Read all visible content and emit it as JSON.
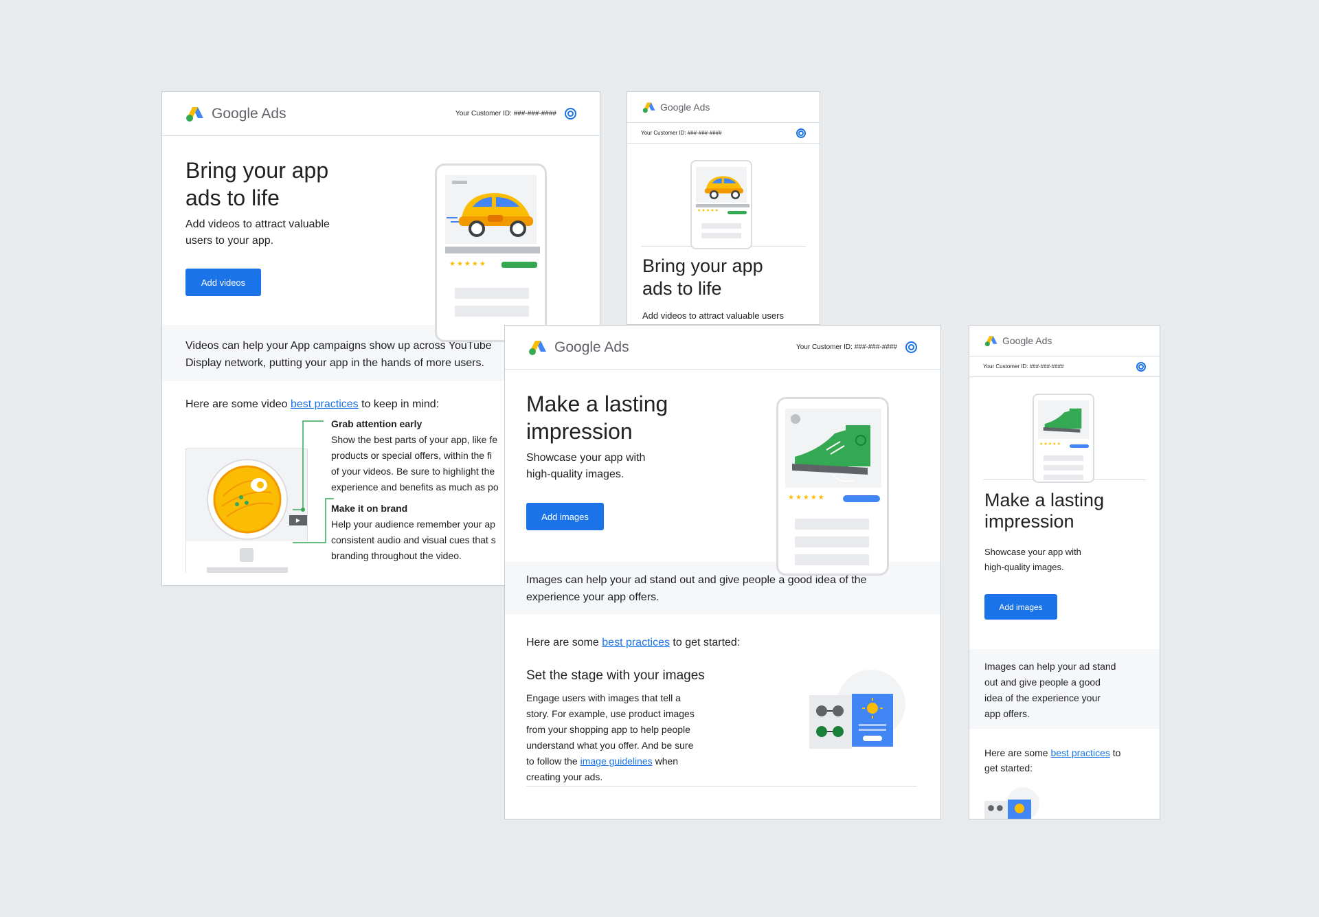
{
  "brand": {
    "name": "Google Ads",
    "customer_id": "Your Customer ID: ###-###-####"
  },
  "colors": {
    "accent": "#1a73e8",
    "logo_blue": "#4285f4",
    "logo_yellow": "#fbbc04",
    "logo_green": "#34a853",
    "background": "#e8ebed"
  },
  "video_email": {
    "title_line1": "Bring your app",
    "title_line2": "ads to life",
    "subtitle_line1": "Add videos to attract valuable",
    "subtitle_line2": "users to your app.",
    "cta": "Add videos",
    "band_line1": "Videos can help your App campaigns show up across YouTube",
    "band_line2": "Display network, putting your app in the hands of more users.",
    "tips_pre": "Here are some video ",
    "tips_link": "best practices",
    "tips_post": " to keep in mind:",
    "tip1_title": "Grab attention early",
    "tip1_l1": "Show the best parts of your app, like fe",
    "tip1_l2": "products or special offers, within the fi",
    "tip1_l3": "of your videos. Be sure to highlight the",
    "tip1_l4": "experience and benefits as much as po",
    "tip2_title": "Make it on brand",
    "tip2_l1": "Help your audience remember your ap",
    "tip2_l2": "consistent audio and visual cues that s",
    "tip2_l3": "branding throughout the video."
  },
  "video_mobile": {
    "title_line1": "Bring your app",
    "title_line2": "ads to life",
    "subtitle": "Add videos to attract valuable users"
  },
  "image_email": {
    "title_line1": "Make a lasting",
    "title_line2": "impression",
    "subtitle_line1": "Showcase your app with",
    "subtitle_line2": "high-quality images.",
    "cta": "Add images",
    "band_line1": "Images can help your ad stand out and give people a good idea of the",
    "band_line2": "experience your app offers.",
    "tips_pre": "Here are some ",
    "tips_link": "best practices",
    "tips_post": " to get started:",
    "section_title": "Set the stage with your images",
    "body_l1": "Engage users with images that tell a",
    "body_l2": "story. For example, use product images",
    "body_l3": "from your shopping app to help people",
    "body_l4": "understand what you offer. And be sure",
    "body_l5_pre": "to follow the ",
    "body_l5_link": "image guidelines",
    "body_l5_post": " when",
    "body_l6": "creating your ads."
  },
  "image_mobile": {
    "title_line1": "Make a lasting",
    "title_line2": "impression",
    "subtitle_line1": "Showcase your app with",
    "subtitle_line2": "high-quality images.",
    "cta": "Add images",
    "band_l1": "Images can help your ad stand",
    "band_l2": "out and give people a good",
    "band_l3": "idea of the experience your",
    "band_l4": "app offers.",
    "tips_pre": "Here are some ",
    "tips_link": "best practices",
    "tips_post": " to",
    "tips_l2": "get started:"
  },
  "icons": {
    "logo": "google-ads-logo-icon",
    "account": "account-circle-icon",
    "play": "play-icon",
    "stars": "★★★★★"
  }
}
